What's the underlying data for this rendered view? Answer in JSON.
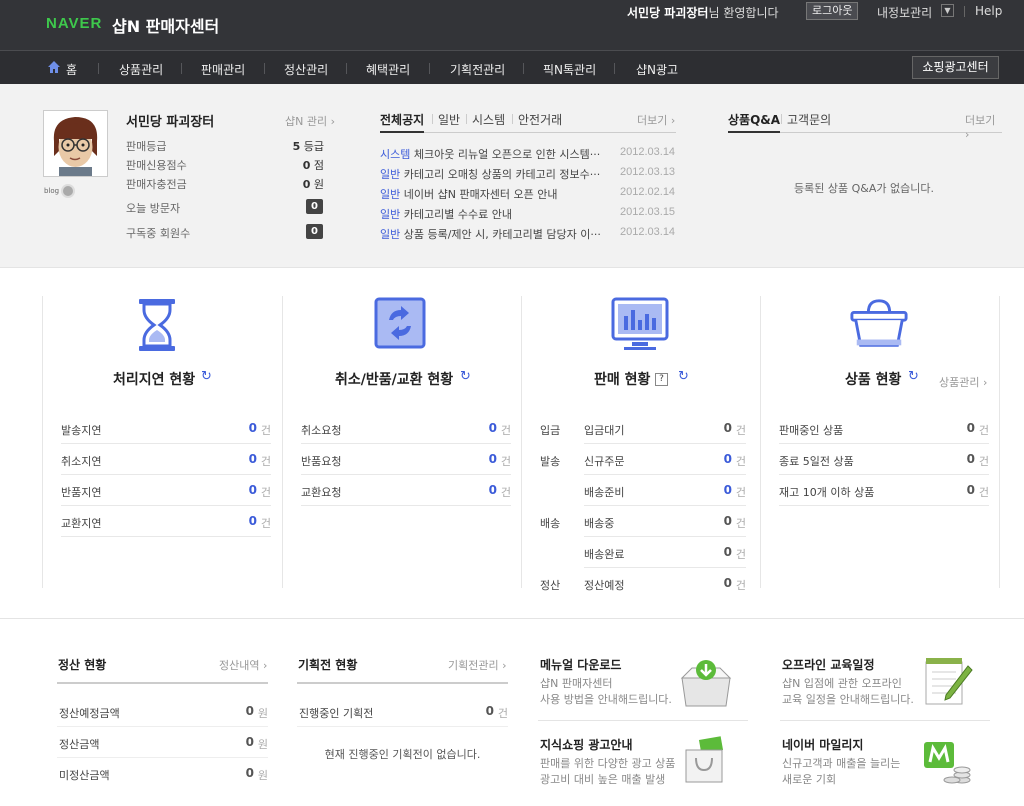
{
  "header": {
    "naver_logo": "NAVER",
    "site_name": "샵N 판매자센터",
    "shop_name": "서민당 파괴장터",
    "welcome_suffix": "님 환영합니다",
    "logout": "로그아웃",
    "my_info": "내정보관리",
    "help": "Help"
  },
  "nav": {
    "home": "홈",
    "items": [
      "상품관리",
      "판매관리",
      "정산관리",
      "혜택관리",
      "기획전관리",
      "픽N톡관리",
      "샵N광고"
    ],
    "ad_center": "쇼핑광고센터"
  },
  "seller": {
    "name": "서민당 파괴장터",
    "manage_link": "샵N 관리 ›",
    "stats": [
      {
        "label": "판매등급",
        "value": "5",
        "unit": "등급"
      },
      {
        "label": "판매신용점수",
        "value": "0",
        "unit": "점"
      },
      {
        "label": "판매자충전금",
        "value": "0",
        "unit": "원"
      }
    ],
    "visitors_label": "오늘 방문자",
    "visitors_value": "0",
    "subscribers_label": "구독중 회원수",
    "subscribers_value": "0"
  },
  "notices": {
    "tabs": [
      "전체공지",
      "일반",
      "시스템",
      "안전거래"
    ],
    "more": "더보기 ›",
    "rows": [
      {
        "cat": "시스템",
        "title": "체크아웃 리뉴얼 오픈으로 인한 시스템···",
        "date": "2012.03.14"
      },
      {
        "cat": "일반",
        "title": "카테고리 오매칭 상품의 카테고리 정보수···",
        "date": "2012.03.13"
      },
      {
        "cat": "일반",
        "title": "네이버 샵N 판매자센터 오픈 안내",
        "date": "2012.02.14"
      },
      {
        "cat": "일반",
        "title": "카테고리별 수수료 안내",
        "date": "2012.03.15"
      },
      {
        "cat": "일반",
        "title": "상품 등록/제안 시, 카테고리별 담당자 이···",
        "date": "2012.03.14"
      }
    ]
  },
  "qna": {
    "tabs": [
      "상품Q&A",
      "고객문의"
    ],
    "more": "더보기 ›",
    "empty": "등록된 상품 Q&A가 없습니다."
  },
  "cards": {
    "delay": {
      "title": "처리지연 현황",
      "rows": [
        {
          "label": "발송지연",
          "value": "0"
        },
        {
          "label": "취소지연",
          "value": "0"
        },
        {
          "label": "반품지연",
          "value": "0"
        },
        {
          "label": "교환지연",
          "value": "0"
        }
      ]
    },
    "cancel": {
      "title": "취소/반품/교환 현황",
      "rows": [
        {
          "label": "취소요청",
          "value": "0"
        },
        {
          "label": "반품요청",
          "value": "0"
        },
        {
          "label": "교환요청",
          "value": "0"
        }
      ]
    },
    "sales": {
      "title": "판매 현황",
      "help": "?",
      "groups": [
        "입금",
        "발송",
        "배송",
        "정산"
      ],
      "rows": [
        {
          "label": "입금대기",
          "value": "0"
        },
        {
          "label": "신규주문",
          "value": "0"
        },
        {
          "label": "배송준비",
          "value": "0"
        },
        {
          "label": "배송중",
          "value": "0"
        },
        {
          "label": "배송완료",
          "value": "0"
        },
        {
          "label": "정산예정",
          "value": "0"
        }
      ]
    },
    "product": {
      "title": "상품 현황",
      "link": "상품관리 ›",
      "rows": [
        {
          "label": "판매중인 상품",
          "value": "0"
        },
        {
          "label": "종료 5일전 상품",
          "value": "0"
        },
        {
          "label": "재고 10개 이하 상품",
          "value": "0"
        }
      ]
    },
    "unit": "건"
  },
  "settlement": {
    "title": "정산 현황",
    "link": "정산내역 ›",
    "rows": [
      {
        "label": "정산예정금액",
        "value": "0"
      },
      {
        "label": "정산금액",
        "value": "0"
      },
      {
        "label": "미정산금액",
        "value": "0"
      }
    ],
    "unit": "원"
  },
  "exhibition": {
    "title": "기획전 현황",
    "link": "기획전관리 ›",
    "row_label": "진행중인 기획전",
    "row_value": "0",
    "unit": "건",
    "empty": "현재 진행중인 기획전이 없습니다."
  },
  "promos": [
    {
      "title": "메뉴얼 다운로드",
      "line1": "샵N 판매자센터",
      "line2": "사용 방법을 안내해드립니다."
    },
    {
      "title": "오프라인 교육일정",
      "line1": "샵N 입점에 관한 오프라인",
      "line2": "교육 일정을 안내해드립니다."
    },
    {
      "title": "지식쇼핑 광고안내",
      "line1": "판매를 위한 다양한 광고 상품",
      "line2": "광고비 대비 높은 매출 발생"
    },
    {
      "title": "네이버 마일리지",
      "line1": "신규고객과 매출을 늘리는",
      "line2": "새로운 기회"
    }
  ],
  "colors": {
    "accent": "#3b5bd9",
    "topbar": "#333438",
    "naver_green": "#3ec84c"
  }
}
